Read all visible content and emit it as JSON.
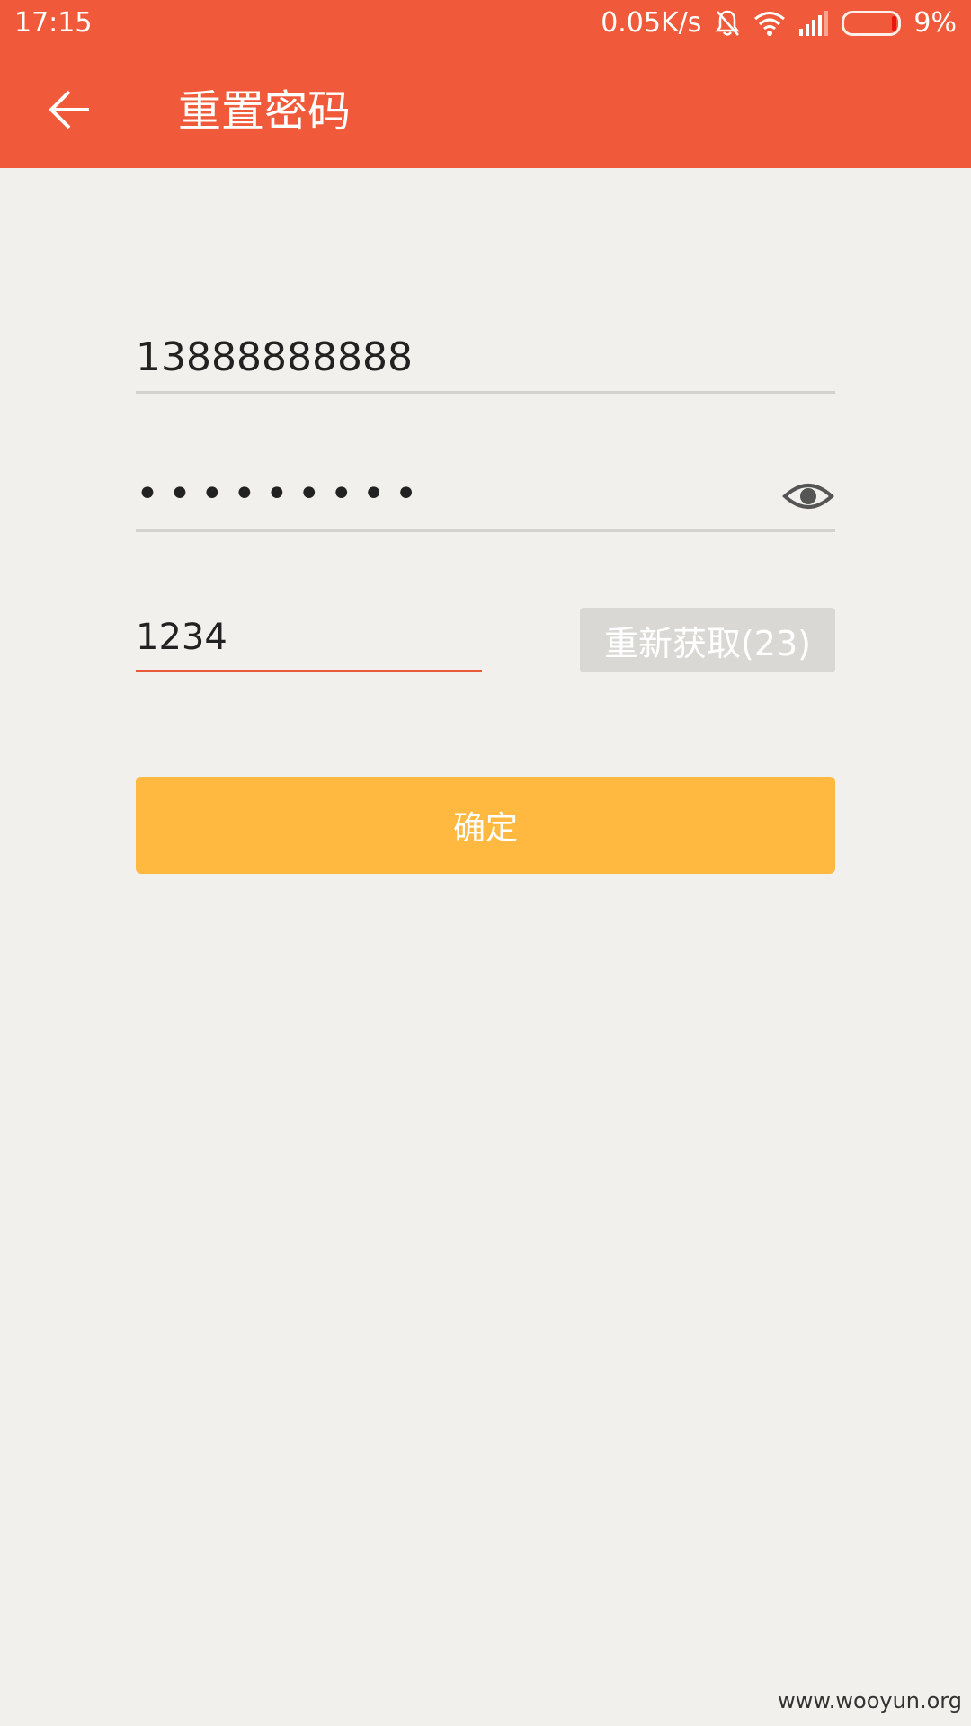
{
  "status_bar": {
    "time": "17:15",
    "net_speed": "0.05K/s",
    "battery_percent": "9%",
    "battery_level": 0.09,
    "icons": [
      "bell-off-icon",
      "wifi-icon",
      "signal-icon",
      "battery-icon"
    ]
  },
  "toolbar": {
    "title": "重置密码",
    "back_icon": "arrow-left-icon"
  },
  "form": {
    "phone_value": "13888888888",
    "password_value": "•••••••••",
    "password_toggle_icon": "eye-icon",
    "code_value": "1234",
    "resend_label": "重新获取(23)",
    "confirm_label": "确定"
  },
  "watermark": "www.wooyun.org",
  "colors": {
    "header": "#f05a3a",
    "background": "#f2f0ec",
    "confirm_button": "#ffb941",
    "resend_button": "#dad8d5",
    "active_underline": "#e85a3a"
  }
}
